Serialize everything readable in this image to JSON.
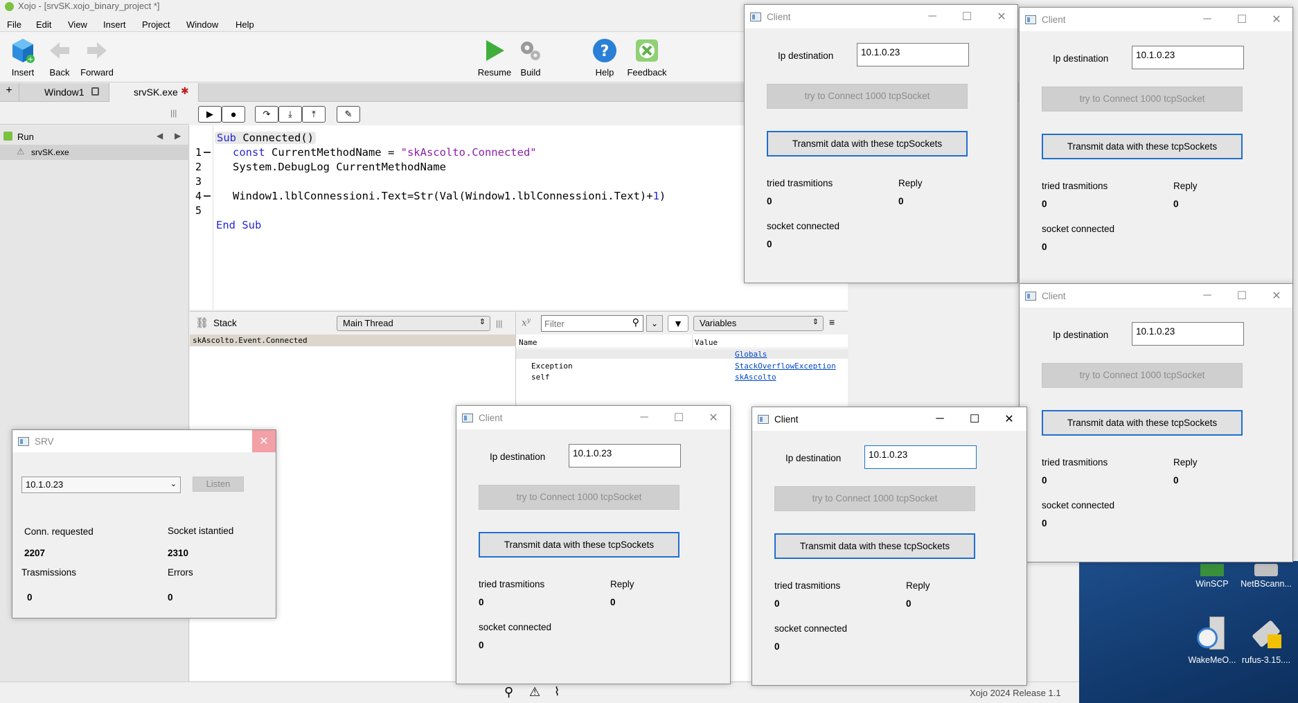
{
  "app": {
    "title": "Xojo - [srvSK.xojo_binary_project *]",
    "version": "Xojo 2024 Release 1.1"
  },
  "menu": [
    "File",
    "Edit",
    "View",
    "Insert",
    "Project",
    "Window",
    "Help"
  ],
  "toolbar": {
    "insert": "Insert",
    "back": "Back",
    "forward": "Forward",
    "resume": "Resume",
    "build": "Build",
    "help": "Help",
    "feedback": "Feedback"
  },
  "tabs": {
    "add": "+",
    "window1": "Window1",
    "run_tab": "srvSK.exe"
  },
  "navigator": {
    "run_label": "Run",
    "run_item": "srvSK.exe"
  },
  "code": {
    "line_numbers": [
      "1",
      "2",
      "3",
      "4",
      "5"
    ],
    "sub_kw": "Sub",
    "sub_name": " Connected()",
    "l1_kw": "const",
    "l1_rest": " CurrentMethodName = ",
    "l1_str": "\"skAscolto.Connected\"",
    "l2": "System.DebugLog CurrentMethodName",
    "l4_a": "Window1.lblConnessioni.Text=Str(Val(Window1.lblConnessioni.Text)+",
    "l4_num": "1",
    "l4_b": ")",
    "end_kw": "End Sub"
  },
  "stack": {
    "title": "Stack",
    "thread": "Main Thread",
    "frame": "skAscolto.Event.Connected"
  },
  "variables": {
    "filter_placeholder": "Filter",
    "scope": "Variables",
    "col_name": "Name",
    "col_value": "Value",
    "rows": [
      {
        "name": "",
        "value": "Globals"
      },
      {
        "name": "Exception",
        "value": "StackOverflowException"
      },
      {
        "name": "self",
        "value": "skAscolto"
      }
    ]
  },
  "srv": {
    "title": "SRV",
    "ip": "10.1.0.23",
    "listen": "Listen",
    "conn_requested_label": "Conn. requested",
    "conn_requested": "2207",
    "socket_label": "Socket istantied",
    "socket": "2310",
    "trans_label": "Trasmissions",
    "trans": "0",
    "errors_label": "Errors",
    "errors": "0"
  },
  "client": {
    "title": "Client",
    "ip_label": "Ip destination",
    "ip": "10.1.0.23",
    "connect_btn": "try to Connect 1000 tcpSocket",
    "transmit_btn": "Transmit data with these tcpSockets",
    "tried_label": "tried trasmitions",
    "tried": "0",
    "reply_label": "Reply",
    "reply": "0",
    "socket_label": "socket connected",
    "socket": "0"
  },
  "desktop": {
    "icons": [
      {
        "label": "WinSCP"
      },
      {
        "label": "NetBScann..."
      },
      {
        "label": "WakeMeO..."
      },
      {
        "label": "rufus-3.15...."
      }
    ]
  },
  "colors": {
    "accent": "#1f6fcf",
    "keyword": "#2626d6",
    "string": "#8a1fa8",
    "close_hover": "#e81123"
  }
}
